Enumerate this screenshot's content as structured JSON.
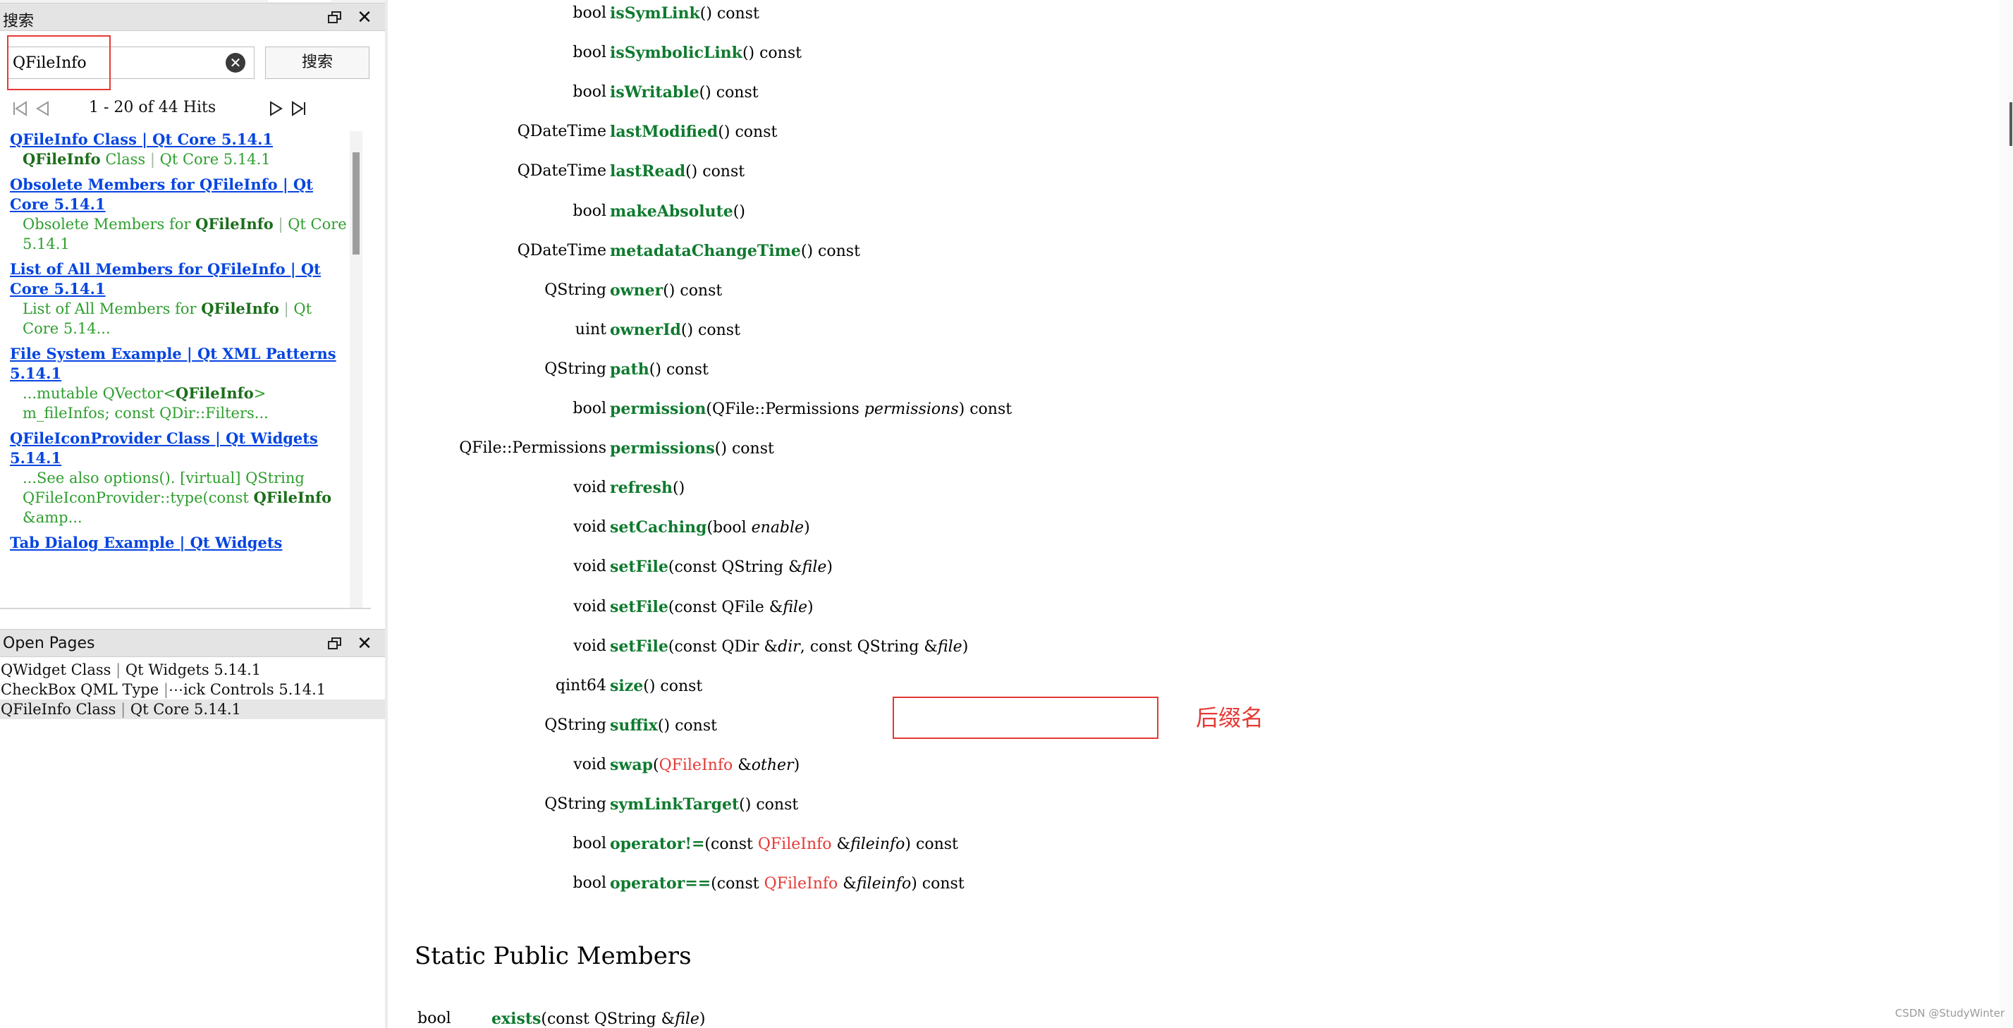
{
  "search_panel": {
    "title": "搜索",
    "query": "QFileInfo",
    "search_button": "搜索",
    "hits_text": "1 - 20 of 44 Hits",
    "results": [
      {
        "title": "QFileInfo Class | Qt Core 5.14.1",
        "snippet_html": "<b>QFileInfo</b> Class <span class='sep'>|</span> Qt Core 5.14.1"
      },
      {
        "title": "Obsolete Members for QFileInfo | Qt Core 5.14.1",
        "snippet_html": "Obsolete Members for <b>QFileInfo</b> <span class='sep'>|</span> Qt Core 5.14.1"
      },
      {
        "title": "List of All Members for QFileInfo | Qt Core 5.14.1",
        "snippet_html": "List of All Members for <b>QFileInfo</b> <span class='sep'>|</span> Qt Core 5.14..."
      },
      {
        "title": "File System Example | Qt XML Patterns 5.14.1",
        "snippet_html": "...mutable QVector&lt;<b>QFileInfo</b>&gt; m_fileInfos; const QDir::Filters..."
      },
      {
        "title": "QFileIconProvider Class | Qt Widgets 5.14.1",
        "snippet_html": "...See also options(). [virtual] QString QFileIconProvider::type(const <b>QFileInfo</b> &amp;amp..."
      },
      {
        "title": "Tab Dialog Example | Qt Widgets",
        "snippet_html": ""
      }
    ]
  },
  "open_pages_panel": {
    "title": "Open Pages",
    "items": [
      {
        "label": "QWidget Class",
        "sub": "Qt Widgets 5.14.1"
      },
      {
        "label": "CheckBox QML Type",
        "sub": "⋯ick Controls 5.14.1"
      },
      {
        "label": "QFileInfo Class",
        "sub": "Qt Core 5.14.1"
      }
    ]
  },
  "members": [
    {
      "type": "bool",
      "fn": "isSymLink",
      "args_html": "()",
      "suffix": " const"
    },
    {
      "type": "bool",
      "fn": "isSymbolicLink",
      "args_html": "()",
      "suffix": " const"
    },
    {
      "type": "bool",
      "fn": "isWritable",
      "args_html": "()",
      "suffix": " const"
    },
    {
      "type": "QDateTime",
      "fn": "lastModified",
      "args_html": "()",
      "suffix": " const"
    },
    {
      "type": "QDateTime",
      "fn": "lastRead",
      "args_html": "()",
      "suffix": " const"
    },
    {
      "type": "bool",
      "fn": "makeAbsolute",
      "args_html": "()",
      "suffix": ""
    },
    {
      "type": "QDateTime",
      "fn": "metadataChangeTime",
      "args_html": "()",
      "suffix": " const"
    },
    {
      "type": "QString",
      "fn": "owner",
      "args_html": "()",
      "suffix": " const"
    },
    {
      "type": "uint",
      "fn": "ownerId",
      "args_html": "()",
      "suffix": " const"
    },
    {
      "type": "QString",
      "fn": "path",
      "args_html": "()",
      "suffix": " const"
    },
    {
      "type": "bool",
      "fn": "permission",
      "args_html": "(QFile::Permissions <span class='param'>permissions</span>)",
      "suffix": " const"
    },
    {
      "type": "QFile::Permissions",
      "fn": "permissions",
      "args_html": "()",
      "suffix": " const"
    },
    {
      "type": "void",
      "fn": "refresh",
      "args_html": "()",
      "suffix": ""
    },
    {
      "type": "void",
      "fn": "setCaching",
      "args_html": "(bool <span class='param'>enable</span>)",
      "suffix": ""
    },
    {
      "type": "void",
      "fn": "setFile",
      "args_html": "(const QString &amp;<span class='param'>file</span>)",
      "suffix": ""
    },
    {
      "type": "void",
      "fn": "setFile",
      "args_html": "(const QFile &amp;<span class='param'>file</span>)",
      "suffix": ""
    },
    {
      "type": "void",
      "fn": "setFile",
      "args_html": "(const QDir &amp;<span class='param'>dir</span>, const QString &amp;<span class='param'>file</span>)",
      "suffix": ""
    },
    {
      "type": "qint64",
      "fn": "size",
      "args_html": "()",
      "suffix": " const"
    },
    {
      "type": "QString",
      "fn": "suffix",
      "args_html": "()",
      "suffix": " const"
    },
    {
      "type": "void",
      "fn": "swap",
      "args_html": "(<span class='red'>QFileInfo</span> &amp;<span class='param'>other</span>)",
      "suffix": ""
    },
    {
      "type": "QString",
      "fn": "symLinkTarget",
      "args_html": "()",
      "suffix": " const"
    },
    {
      "type": "bool",
      "fn": "operator!=",
      "args_html": "(const <span class='red'>QFileInfo</span> &amp;<span class='param'>fileinfo</span>)",
      "suffix": " const"
    },
    {
      "type": "bool",
      "fn": "operator==",
      "args_html": "(const <span class='red'>QFileInfo</span> &amp;<span class='param'>fileinfo</span>)",
      "suffix": " const"
    }
  ],
  "annotation": {
    "text": "后缀名"
  },
  "static_section": {
    "heading": "Static Public Members",
    "first_row": {
      "type": "bool",
      "fn": "exists",
      "args_html": "(const QString &amp;<span class='param'>file</span>)"
    }
  },
  "watermark": "CSDN @StudyWinter",
  "colors": {
    "link": "#0645e0",
    "snippet": "#2e9e2e",
    "function": "#0f7a2f",
    "annotation": "#e53935"
  },
  "icons": [
    "float-icon",
    "close-icon",
    "clear-icon",
    "first-page-icon",
    "prev-page-icon",
    "next-page-icon",
    "last-page-icon"
  ]
}
